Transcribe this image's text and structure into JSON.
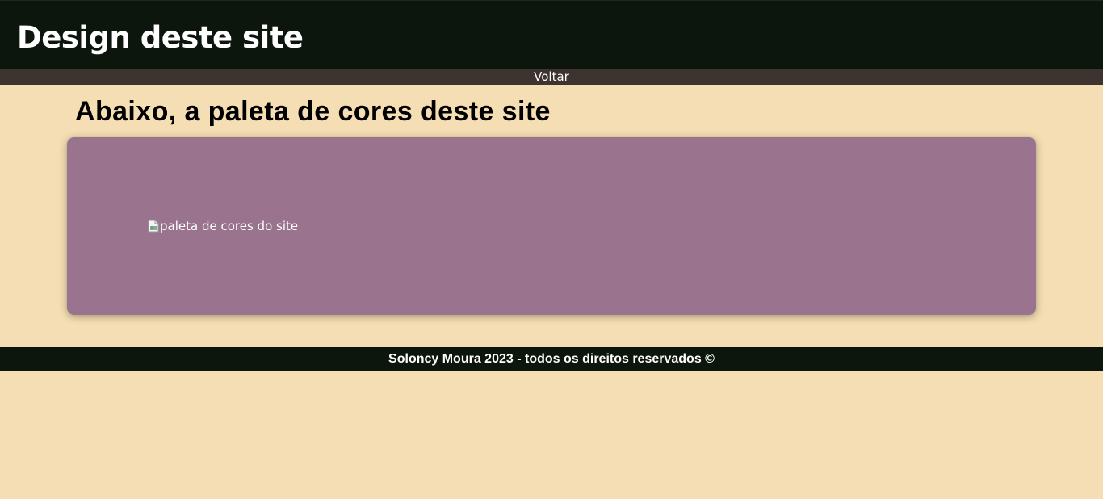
{
  "header": {
    "title": "Design deste site"
  },
  "nav": {
    "back_label": "Voltar"
  },
  "main": {
    "section_title": "Abaixo, a paleta de cores deste site",
    "palette_image": {
      "alt": "paleta de cores do site",
      "icon": "broken-image-icon"
    }
  },
  "footer": {
    "text": "Soloncy Moura 2023 - todos os direitos reservados ©"
  },
  "colors": {
    "page_background": "#f5deb3",
    "header_background": "#0c160c",
    "nav_background": "#3d3430",
    "card_background": "#9a738e",
    "footer_background": "#0c160c",
    "text_light": "#ffffff",
    "text_dark": "#000000"
  }
}
